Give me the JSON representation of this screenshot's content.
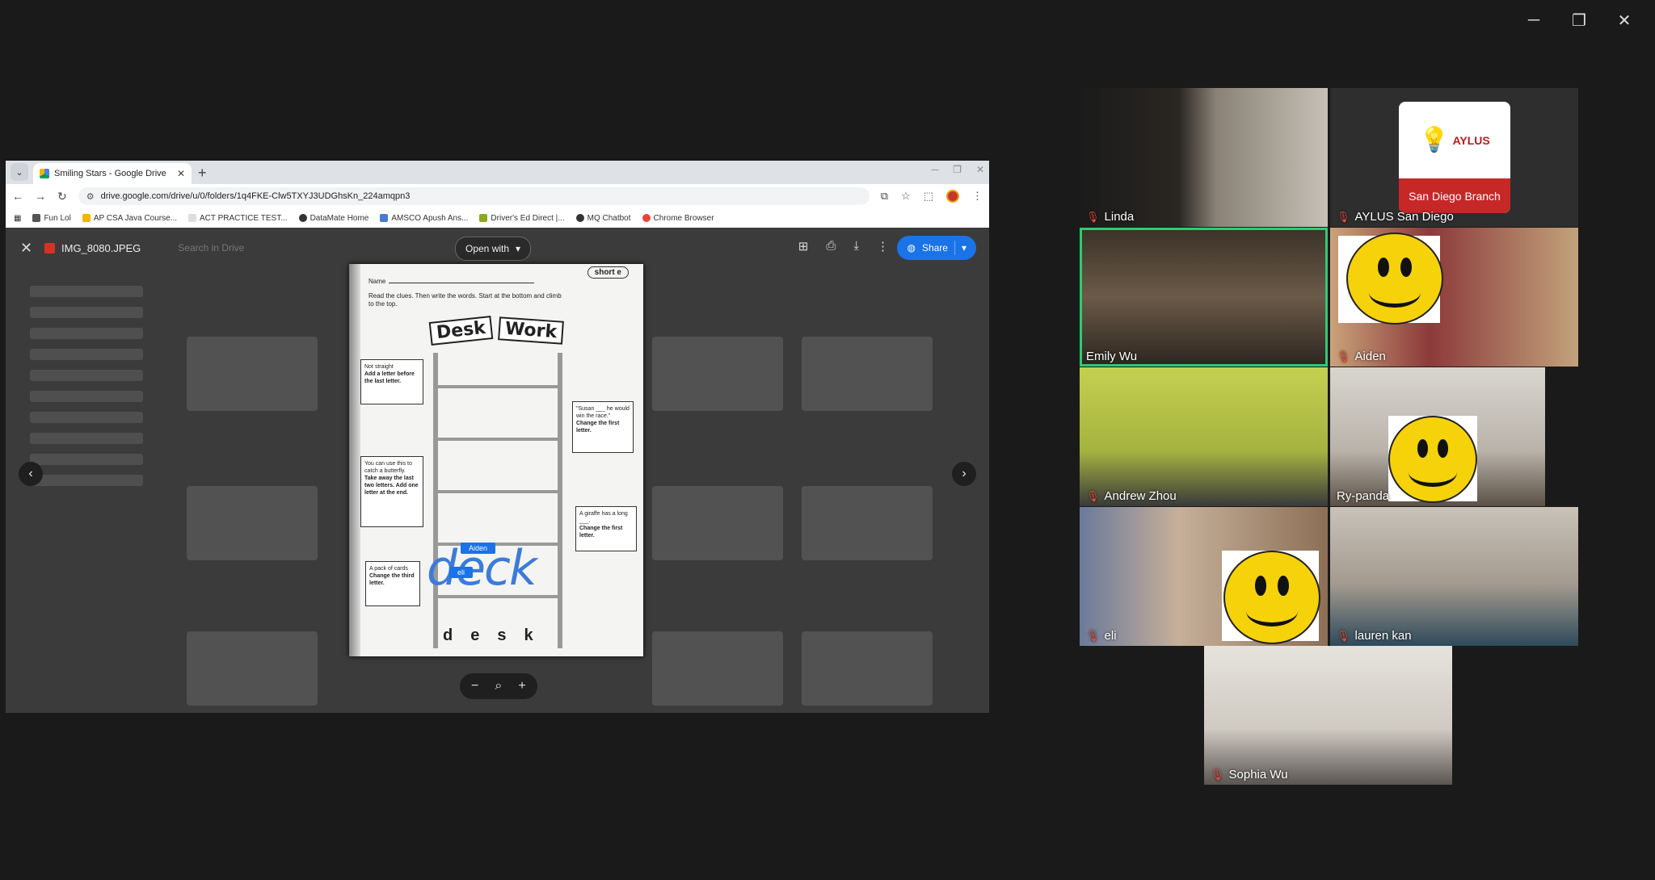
{
  "window_controls": {
    "minimize": "─",
    "restore": "❐",
    "close": "✕"
  },
  "browser": {
    "tab_list_icon": "⌄",
    "tab_title": "Smiling Stars - Google Drive",
    "tab_close": "✕",
    "new_tab": "+",
    "url": "drive.google.com/drive/u/0/folders/1q4FKE-Clw5TXYJ3UDGhsKn_224amqpn3",
    "bookmarks": [
      {
        "label": "Fun Lol",
        "color": "#555555"
      },
      {
        "label": "AP CSA Java Course...",
        "color": "#f4b400"
      },
      {
        "label": "ACT PRACTICE TEST...",
        "color": "#dddddd"
      },
      {
        "label": "DataMate Home",
        "color": "#333333"
      },
      {
        "label": "AMSCO Apush Ans...",
        "color": "#4a7bd0"
      },
      {
        "label": "Driver's Ed Direct |...",
        "color": "#8aa820"
      },
      {
        "label": "MQ Chatbot",
        "color": "#333333"
      },
      {
        "label": "Chrome Browser",
        "color": "#ea4335"
      }
    ]
  },
  "viewer": {
    "file_name": "IMG_8080.JPEG",
    "search_placeholder": "Search in Drive",
    "open_with": "Open with",
    "share": "Share"
  },
  "worksheet": {
    "label": "short e",
    "name_label": "Name",
    "instructions": "Read the clues. Then write the words. Start at the bottom and climb to the top.",
    "title_left": "Desk",
    "title_right": "Work",
    "clues": [
      {
        "text": "Not straight",
        "bold": "Add a letter before the last letter."
      },
      {
        "text": "\"Susan ___ he would win the race.\"",
        "bold": "Change the first letter."
      },
      {
        "text": "You can use this to catch a butterfly.",
        "bold": "Take away the last two letters. Add one letter at the end."
      },
      {
        "text": "A giraffe has a long ___.",
        "bold": "Change the first letter."
      },
      {
        "text": "A pack of cards",
        "bold": "Change the third letter."
      }
    ],
    "answer_letters": [
      "d",
      "e",
      "s",
      "k"
    ],
    "annotation_text": "deck",
    "cursor_tags": [
      "Aiden",
      "eli"
    ]
  },
  "participants": [
    {
      "name": "Linda"
    },
    {
      "name": "AYLUS San Diego",
      "logo_title": "AYLUS",
      "logo_sub": "San Diego Branch"
    },
    {
      "name": "Emily Wu"
    },
    {
      "name": "Aiden"
    },
    {
      "name": "Andrew Zhou"
    },
    {
      "name": "Ry-panda"
    },
    {
      "name": "eli"
    },
    {
      "name": "lauren kan"
    },
    {
      "name": "Sophia Wu"
    }
  ],
  "colors": {
    "active_speaker": "#2ecc71",
    "share_button": "#1a73e8",
    "muted": "#e74c3c"
  }
}
